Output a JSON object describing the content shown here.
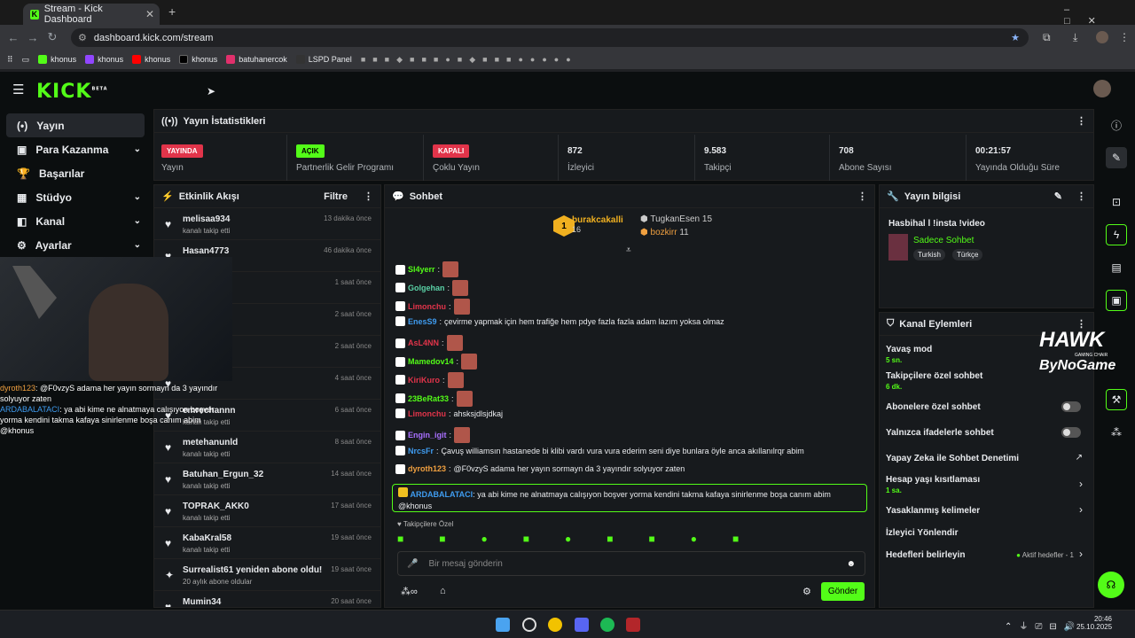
{
  "browser": {
    "tab_title": "Stream - Kick Dashboard",
    "url": "dashboard.kick.com/stream",
    "bookmarks": [
      "khonus",
      "khonus",
      "khonus",
      "khonus",
      "batuhanercok",
      "LSPD Panel"
    ]
  },
  "kick": {
    "logo": "KICK",
    "beta": "BETA"
  },
  "sidebar": [
    {
      "label": "Yayın",
      "icon": "(•)"
    },
    {
      "label": "Para Kazanma",
      "icon": "▣"
    },
    {
      "label": "Başarılar",
      "icon": "🏆"
    },
    {
      "label": "Stüdyo",
      "icon": "▦"
    },
    {
      "label": "Kanal",
      "icon": "◧"
    },
    {
      "label": "Ayarlar",
      "icon": "⚙"
    }
  ],
  "cam_chat": [
    {
      "user": "dyroth123",
      "text": ": @F0vzyS adama her yayın sormayn da 3 yayındır solyuyor zaten"
    },
    {
      "user": "ARDABALATACI",
      "text": ": ya abi kime ne alnatmaya calışıyon boşver yorma kendini takma kafaya sinirlenme boşa canım abim @khonus"
    }
  ],
  "stats": {
    "title": "Yayın İstatistikleri",
    "items": [
      {
        "badge": "YAYINDA",
        "label": "Yayın",
        "color": "#e1344a"
      },
      {
        "badge": "AÇIK",
        "label": "Partnerlik Gelir Programı",
        "color": "#53fc18"
      },
      {
        "badge": "KAPALI",
        "label": "Çoklu Yayın",
        "color": "#e1344a"
      },
      {
        "val": "872",
        "label": "İzleyici"
      },
      {
        "val": "9.583",
        "label": "Takipçi"
      },
      {
        "val": "708",
        "label": "Abone Sayısı"
      },
      {
        "val": "00:21:57",
        "label": "Yayında Olduğu Süre"
      }
    ]
  },
  "events": {
    "title": "Etkinlik Akışı",
    "filter": "Filtre",
    "items": [
      {
        "name": "melisaa934",
        "sub": "kanalı takip etti",
        "time": "13 dakika önce"
      },
      {
        "name": "Hasan4773",
        "sub": "",
        "time": "46 dakika önce"
      },
      {
        "name": "",
        "sub": "",
        "time": "1 saat önce"
      },
      {
        "name": "",
        "sub": "",
        "time": "2 saat önce"
      },
      {
        "name": "",
        "sub": "",
        "time": "2 saat önce"
      },
      {
        "name": "",
        "sub": "",
        "time": "4 saat önce"
      },
      {
        "name": "emrechannn",
        "sub": "kanalı takip etti",
        "time": "6 saat önce"
      },
      {
        "name": "metehanunld",
        "sub": "kanalı takip etti",
        "time": "8 saat önce"
      },
      {
        "name": "Batuhan_Ergun_32",
        "sub": "kanalı takip etti",
        "time": "14 saat önce"
      },
      {
        "name": "TOPRAK_AKK0",
        "sub": "kanalı takip etti",
        "time": "17 saat önce"
      },
      {
        "name": "KabaKral58",
        "sub": "kanalı takip etti",
        "time": "19 saat önce"
      },
      {
        "name": "Surrealist61 yeniden abone oldu!",
        "sub": "20 aylık abone oldular",
        "time": "19 saat önce"
      },
      {
        "name": "Mumin34",
        "sub": "",
        "time": "20 saat önce"
      }
    ]
  },
  "chat": {
    "title": "Sohbet",
    "top": [
      {
        "name": "burakcakalli",
        "n": "16"
      },
      {
        "name": "TugkanEsen",
        "n": "15"
      },
      {
        "name": "bozkirr",
        "n": "11"
      }
    ],
    "messages": [
      {
        "user": "Sl4yerr",
        "color": "#53fc18",
        "text": "",
        "emote": true
      },
      {
        "user": "Golgehan",
        "color": "#5ad1a6",
        "text": "",
        "emote": true
      },
      {
        "user": "Limonchu",
        "color": "#e1344a",
        "text": "",
        "emote": true
      },
      {
        "user": "EnesS9",
        "color": "#3f9cf0",
        "text": "çevirme yapmak için hem trafiğe hem pdye fazla fazla adam lazım yoksa olmaz",
        "emote": false
      },
      {
        "user": "AsL4NN",
        "color": "#e1344a",
        "text": "",
        "emote": true
      },
      {
        "user": "Mamedov14",
        "color": "#53fc18",
        "text": "",
        "emote": true
      },
      {
        "user": "KiriKuro",
        "color": "#e1344a",
        "text": "",
        "emote": true
      },
      {
        "user": "23BeRat33",
        "color": "#53fc18",
        "text": "",
        "emote": true
      },
      {
        "user": "Limonchu",
        "color": "#e1344a",
        "text": "ahsksjdlsjdkaj",
        "emote": false
      },
      {
        "user": "Engin_igit",
        "color": "#a970ff",
        "text": "",
        "emote": true
      },
      {
        "user": "NrcsFr",
        "color": "#3f9cf0",
        "text": "Çavuş williamsın hastanede bi klibi vardı vura vura ederim seni diye bunlara öyle anca akıllanılrqr abim",
        "emote": false
      },
      {
        "user": "dyroth123",
        "color": "#f0a040",
        "text": "@F0vzyS adama her yayın sormayn da 3 yayındır solyuyor zaten",
        "emote": false
      }
    ],
    "highlight": {
      "user": "ARDABALATACI",
      "text": "ya abi kime ne alnatmaya calışıyon boşver yorma kendini takma kafaya sinirlenme boşa canım abim @khonus"
    },
    "followers_only": "Takipçilere Özel",
    "placeholder": "Bir mesaj gönderin",
    "send": "Gönder"
  },
  "info": {
    "title": "Yayın bilgisi",
    "stream_title": "Hasbihal l !insta !video",
    "category": "Sadece Sohbet",
    "tags": [
      "Turkish",
      "Türkçe"
    ]
  },
  "actions": {
    "title": "Kanal Eylemleri",
    "items": [
      {
        "label": "Yavaş mod",
        "sub": "5 sn."
      },
      {
        "label": "Takipçilere özel sohbet",
        "sub": "6 dk."
      },
      {
        "label": "Abonelere özel sohbet",
        "sub": ""
      },
      {
        "label": "Yalnızca ifadelerle sohbet",
        "sub": ""
      },
      {
        "label": "Yapay Zeka ile Sohbet Denetimi",
        "sub": ""
      },
      {
        "label": "Hesap yaşı kısıtlaması",
        "sub": "1 sa."
      },
      {
        "label": "Yasaklanmış kelimeler",
        "sub": ""
      },
      {
        "label": "İzleyici Yönlendir",
        "sub": ""
      },
      {
        "label": "Hedefleri belirleyin",
        "sub": ""
      }
    ],
    "goals_status": "Aktif hedefler - 1"
  },
  "overlay": {
    "hawk": "HAWK",
    "hawk_sub": "GAMING CHAIR",
    "bynogame": "ByNoGame"
  },
  "clock": {
    "time": "20:46",
    "date": "25.10.2025"
  }
}
